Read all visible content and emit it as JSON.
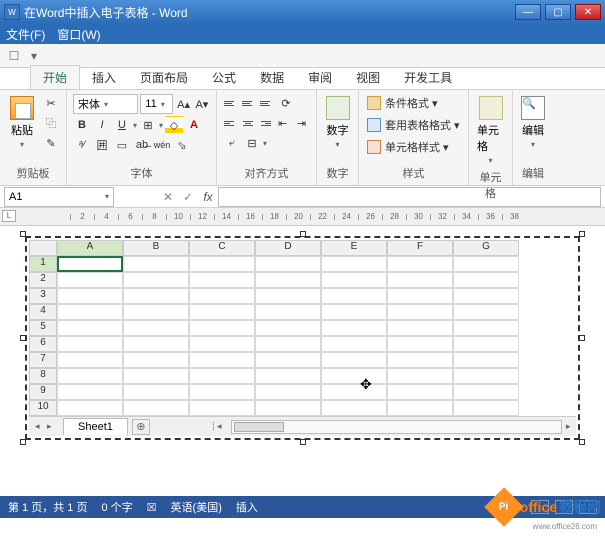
{
  "titlebar": {
    "icon_label": "W",
    "title": "在Word中插入电子表格 - Word"
  },
  "wordmenu": {
    "file": "文件(F)",
    "window": "窗口(W)"
  },
  "qat": {
    "item1": "☐",
    "item2": "▾"
  },
  "tabs": [
    "开始",
    "插入",
    "页面布局",
    "公式",
    "数据",
    "审阅",
    "视图",
    "开发工具"
  ],
  "ribbon": {
    "clipboard": {
      "paste_label": "粘贴",
      "group_label": "剪贴板"
    },
    "font": {
      "family": "宋体",
      "size": "11",
      "group_label": "字体"
    },
    "align": {
      "group_label": "对齐方式"
    },
    "number": {
      "label": "数字",
      "group_label": "数字"
    },
    "styles": {
      "cond": "条件格式 ▾",
      "table": "套用表格格式 ▾",
      "cell": "单元格样式 ▾",
      "group_label": "样式"
    },
    "cells": {
      "label": "单元格"
    },
    "editing": {
      "label": "编辑"
    }
  },
  "formulabar": {
    "namebox": "A1",
    "fx": "fx"
  },
  "ruler_ticks": [
    "2",
    "4",
    "6",
    "8",
    "10",
    "12",
    "14",
    "16",
    "18",
    "20",
    "22",
    "24",
    "26",
    "28",
    "30",
    "32",
    "34",
    "36",
    "38"
  ],
  "sheet": {
    "cols": [
      "A",
      "B",
      "C",
      "D",
      "E",
      "F",
      "G"
    ],
    "rows": [
      "1",
      "2",
      "3",
      "4",
      "5",
      "6",
      "7",
      "8",
      "9",
      "10"
    ],
    "tab_name": "Sheet1",
    "newsheet": "⊕"
  },
  "status": {
    "page": "第 1 页，共 1 页",
    "words": "0 个字",
    "proof": "☒",
    "lang": "英语(美国)",
    "mode": "插入"
  },
  "watermark": {
    "badge": "Pi",
    "t1": "office",
    "t2": "教程网",
    "sub": "www.office26.com"
  }
}
